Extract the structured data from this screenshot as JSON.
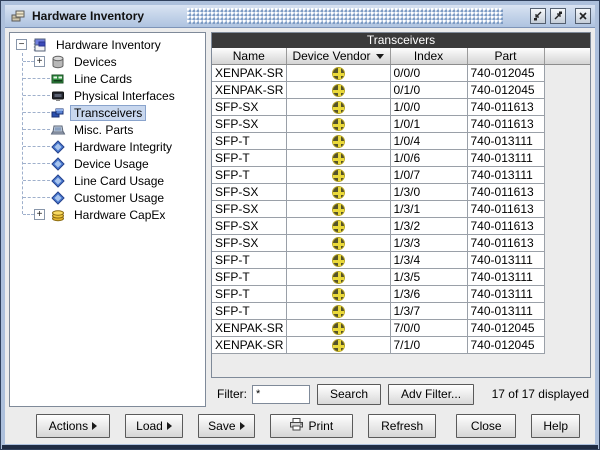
{
  "window": {
    "title": "Hardware Inventory",
    "controls": [
      "minimize",
      "maximize",
      "close"
    ]
  },
  "colors": {
    "titlebar": "#b6c8e2",
    "table_caption_bg": "#3a3a3a",
    "tree_selection_bg": "#c8d7ee",
    "vendor_icon_yellow": "#ead93a",
    "vendor_icon_dark": "#55532a"
  },
  "sidebar": {
    "items": [
      {
        "label": "Hardware Inventory",
        "level": 0,
        "toggle": "collapse",
        "icon": "hardware-inventory",
        "selected": false
      },
      {
        "label": "Devices",
        "level": 1,
        "toggle": "expand",
        "icon": "devices",
        "selected": false
      },
      {
        "label": "Line Cards",
        "level": 1,
        "toggle": null,
        "icon": "line-cards",
        "selected": false
      },
      {
        "label": "Physical Interfaces",
        "level": 1,
        "toggle": null,
        "icon": "physical-interfaces",
        "selected": false
      },
      {
        "label": "Transceivers",
        "level": 1,
        "toggle": null,
        "icon": "transceivers",
        "selected": true
      },
      {
        "label": "Misc. Parts",
        "level": 1,
        "toggle": null,
        "icon": "misc-parts",
        "selected": false
      },
      {
        "label": "Hardware Integrity",
        "level": 1,
        "toggle": null,
        "icon": "report",
        "selected": false
      },
      {
        "label": "Device Usage",
        "level": 1,
        "toggle": null,
        "icon": "report",
        "selected": false
      },
      {
        "label": "Line Card Usage",
        "level": 1,
        "toggle": null,
        "icon": "report",
        "selected": false
      },
      {
        "label": "Customer Usage",
        "level": 1,
        "toggle": null,
        "icon": "report",
        "selected": false
      },
      {
        "label": "Hardware CapEx",
        "level": 1,
        "toggle": "expand",
        "icon": "capex",
        "selected": false
      }
    ]
  },
  "table": {
    "title": "Transceivers",
    "columns": [
      {
        "label": "Name"
      },
      {
        "label": "Device Vendor",
        "sort": "desc"
      },
      {
        "label": "Index"
      },
      {
        "label": "Part"
      }
    ],
    "rows": [
      {
        "name": "XENPAK-SR",
        "vendor_icon": "vendor-logo",
        "index": "0/0/0",
        "part": "740-012045"
      },
      {
        "name": "XENPAK-SR",
        "vendor_icon": "vendor-logo",
        "index": "0/1/0",
        "part": "740-012045"
      },
      {
        "name": "SFP-SX",
        "vendor_icon": "vendor-logo",
        "index": "1/0/0",
        "part": "740-011613"
      },
      {
        "name": "SFP-SX",
        "vendor_icon": "vendor-logo",
        "index": "1/0/1",
        "part": "740-011613"
      },
      {
        "name": "SFP-T",
        "vendor_icon": "vendor-logo",
        "index": "1/0/4",
        "part": "740-013111"
      },
      {
        "name": "SFP-T",
        "vendor_icon": "vendor-logo",
        "index": "1/0/6",
        "part": "740-013111"
      },
      {
        "name": "SFP-T",
        "vendor_icon": "vendor-logo",
        "index": "1/0/7",
        "part": "740-013111"
      },
      {
        "name": "SFP-SX",
        "vendor_icon": "vendor-logo",
        "index": "1/3/0",
        "part": "740-011613"
      },
      {
        "name": "SFP-SX",
        "vendor_icon": "vendor-logo",
        "index": "1/3/1",
        "part": "740-011613"
      },
      {
        "name": "SFP-SX",
        "vendor_icon": "vendor-logo",
        "index": "1/3/2",
        "part": "740-011613"
      },
      {
        "name": "SFP-SX",
        "vendor_icon": "vendor-logo",
        "index": "1/3/3",
        "part": "740-011613"
      },
      {
        "name": "SFP-T",
        "vendor_icon": "vendor-logo",
        "index": "1/3/4",
        "part": "740-013111"
      },
      {
        "name": "SFP-T",
        "vendor_icon": "vendor-logo",
        "index": "1/3/5",
        "part": "740-013111"
      },
      {
        "name": "SFP-T",
        "vendor_icon": "vendor-logo",
        "index": "1/3/6",
        "part": "740-013111"
      },
      {
        "name": "SFP-T",
        "vendor_icon": "vendor-logo",
        "index": "1/3/7",
        "part": "740-013111"
      },
      {
        "name": "XENPAK-SR",
        "vendor_icon": "vendor-logo",
        "index": "7/0/0",
        "part": "740-012045"
      },
      {
        "name": "XENPAK-SR",
        "vendor_icon": "vendor-logo",
        "index": "7/1/0",
        "part": "740-012045"
      }
    ]
  },
  "filter": {
    "label": "Filter:",
    "value": "*",
    "search_label": "Search",
    "adv_filter_label": "Adv Filter...",
    "status": "17 of 17 displayed"
  },
  "footer": {
    "buttons": [
      {
        "label": "Actions",
        "menu": true
      },
      {
        "label": "Load",
        "menu": true
      },
      {
        "label": "Save",
        "menu": true
      },
      {
        "label": "Print",
        "icon": "printer"
      },
      {
        "label": "Refresh"
      },
      {
        "label": "Close"
      },
      {
        "label": "Help"
      }
    ]
  }
}
